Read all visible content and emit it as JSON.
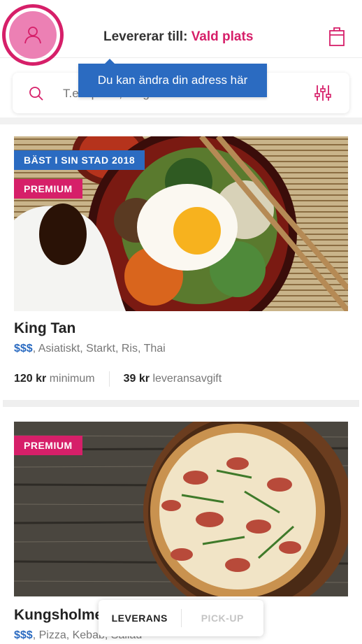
{
  "header": {
    "deliver_prefix": "Levererar till:",
    "deliver_place": "Vald plats"
  },
  "tooltip": {
    "text": "Du kan ändra din adress här"
  },
  "search": {
    "placeholder": "T.ex. pizza, burgare"
  },
  "restaurants": [
    {
      "badges": [
        "BÄST I SIN STAD 2018",
        "PREMIUM"
      ],
      "name": "King Tan",
      "price_level": "$$$",
      "tags": ", Asiatiskt, Starkt, Ris, Thai",
      "minimum_value": "120 kr",
      "minimum_label": "minimum",
      "fee_value": "39 kr",
      "fee_label": "leveransavgift"
    },
    {
      "badges": [
        "PREMIUM"
      ],
      "name": "Kungsholmens",
      "price_level": "$$$",
      "tags": ", Pizza, Kebab, Sallad"
    }
  ],
  "mode_toggle": {
    "delivery": "LEVERANS",
    "pickup": "PICK-UP",
    "selected": "LEVERANS"
  },
  "colors": {
    "brand_pink": "#d61f69",
    "brand_blue": "#2b6bc1"
  },
  "icons": {
    "avatar": "user-icon",
    "cart": "shopping-bag-icon",
    "search": "search-icon",
    "filter": "filter-sliders-icon"
  }
}
